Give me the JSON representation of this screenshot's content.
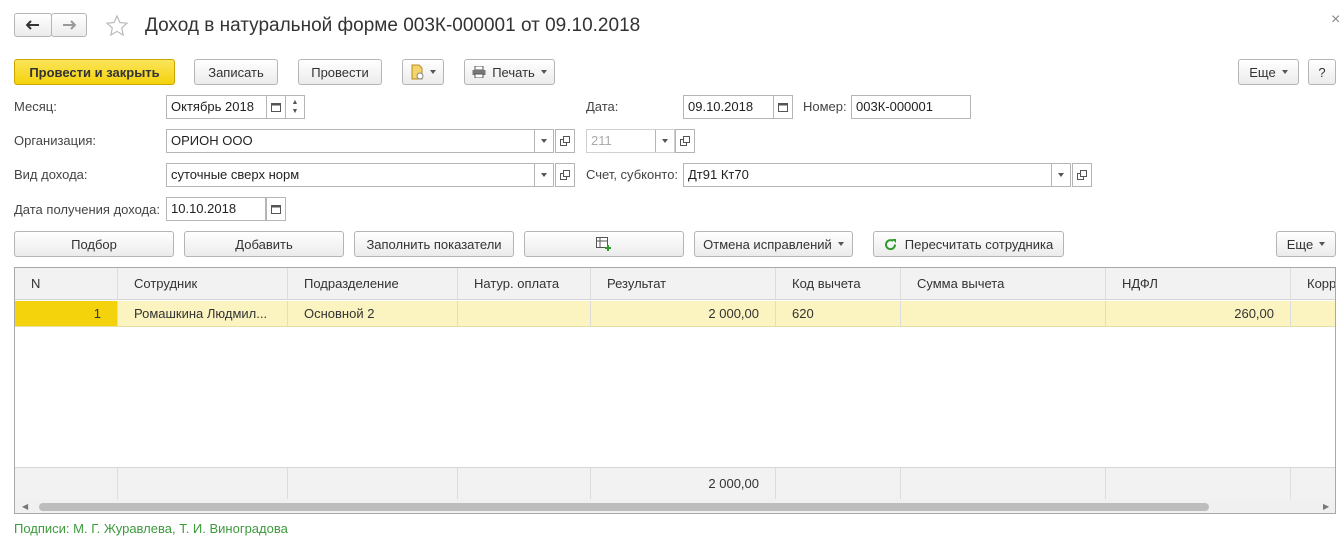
{
  "window": {
    "title": "Доход в натуральной форме 003К-000001 от 09.10.2018",
    "close_glyph": "×"
  },
  "toolbar": {
    "post_close": "Провести и закрыть",
    "save": "Записать",
    "post": "Провести",
    "print": "Печать",
    "more": "Еще",
    "help": "?"
  },
  "form": {
    "month_label": "Месяц:",
    "month_value": "Октябрь 2018",
    "date_label": "Дата:",
    "date_value": "09.10.2018",
    "number_label": "Номер:",
    "number_value": "003К-000001",
    "org_label": "Организация:",
    "org_value": "ОРИОН ООО",
    "code_value": "211",
    "income_type_label": "Вид дохода:",
    "income_type_value": "суточные сверх норм",
    "account_label": "Счет, субконто:",
    "account_value": "Дт91 Кт70",
    "income_date_label": "Дата получения дохода:",
    "income_date_value": "10.10.2018"
  },
  "table_toolbar": {
    "pick": "Подбор",
    "add": "Добавить",
    "fill": "Заполнить показатели",
    "cancel_fixes": "Отмена исправлений",
    "recalc": "Пересчитать сотрудника",
    "more": "Еще"
  },
  "table": {
    "columns": [
      "N",
      "Сотрудник",
      "Подразделение",
      "Натур. оплата",
      "Результат",
      "Код вычета",
      "Сумма вычета",
      "НДФЛ",
      "Корр"
    ],
    "rows": [
      [
        "1",
        "Ромашкина Людмил...",
        "Основной 2",
        "",
        "2 000,00",
        "620",
        "",
        "260,00",
        ""
      ]
    ],
    "footer_total": "2 000,00"
  },
  "status": {
    "signatures": "Подписи: М. Г. Журавлева, Т. И. Виноградова"
  },
  "colors": {
    "accent_yellow": "#f4d20c",
    "selected_row": "#fbf3c0",
    "link_green": "#3c9a3c"
  }
}
